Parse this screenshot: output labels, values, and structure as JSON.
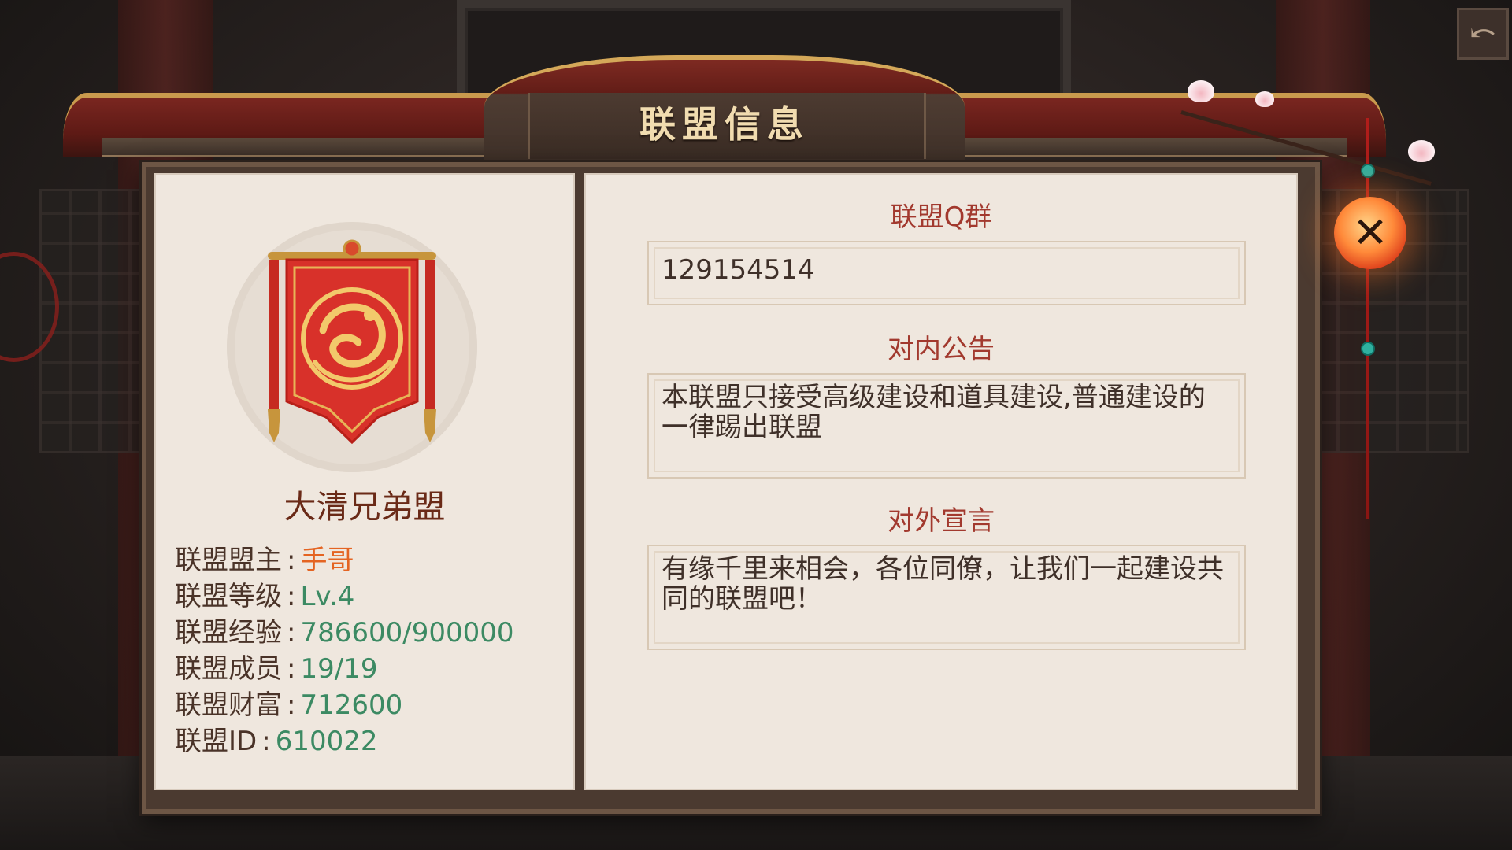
{
  "header": {
    "title": "联盟信息"
  },
  "alliance": {
    "name": "大清兄弟盟",
    "stats": [
      {
        "label": "联盟盟主",
        "colon": ":",
        "value": "手哥",
        "tone": "orange"
      },
      {
        "label": "联盟等级",
        "colon": ":",
        "value": "Lv.4",
        "tone": "green"
      },
      {
        "label": "联盟经验",
        "colon": ":",
        "value": "786600/900000",
        "tone": "green"
      },
      {
        "label": "联盟成员",
        "colon": ":",
        "value": "19/19",
        "tone": "green"
      },
      {
        "label": "联盟财富",
        "colon": ":",
        "value": "712600",
        "tone": "green"
      },
      {
        "label": "联盟ID",
        "colon": ":",
        "value": "610022",
        "tone": "green"
      }
    ]
  },
  "sections": {
    "qq_group": {
      "title": "联盟Q群",
      "value": "129154514"
    },
    "internal_notice": {
      "title": "对内公告",
      "text": "本联盟只接受高级建设和道具建设,普通建设的一律踢出联盟"
    },
    "external_declaration": {
      "title": "对外宣言",
      "text": "有缘千里来相会，各位同僚，让我们一起建设共同的联盟吧！"
    }
  },
  "icons": {
    "close": "close-icon",
    "emblem": "dragon-banner-icon"
  },
  "colors": {
    "title_red": "#a2392e",
    "value_green": "#3c8a63",
    "value_orange": "#e46422",
    "panel_bg": "#efe7de"
  }
}
